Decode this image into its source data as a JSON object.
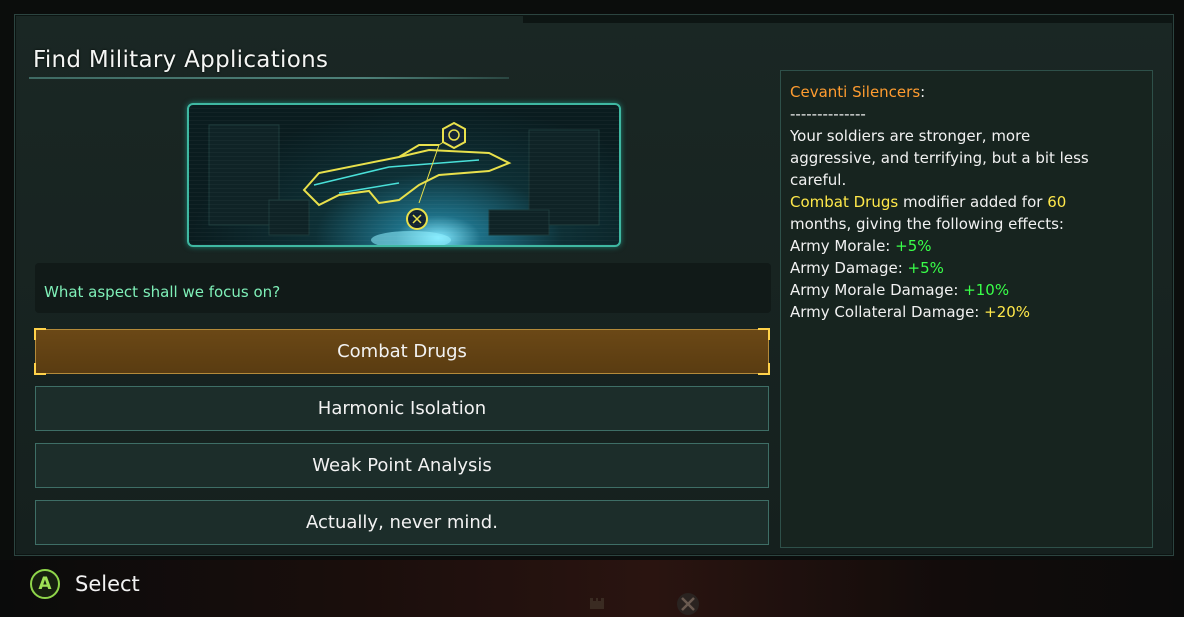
{
  "window": {
    "title": "Find Military Applications"
  },
  "picture": {
    "icon": "rifle-hologram-illustration"
  },
  "question": "What aspect shall we focus on?",
  "options": [
    {
      "label": "Combat Drugs",
      "selected": true
    },
    {
      "label": "Harmonic Isolation",
      "selected": false
    },
    {
      "label": "Weak Point Analysis",
      "selected": false
    },
    {
      "label": "Actually, never mind.",
      "selected": false
    }
  ],
  "description": {
    "heading": "Cevanti Silencers",
    "heading_suffix": ":",
    "separator": "--------------",
    "text_line1": "Your soldiers are stronger, more",
    "text_line2": "aggressive, and terrifying, but a bit less",
    "text_line3": "careful.",
    "modifier_name": "Combat Drugs",
    "modifier_mid": " modifier added for ",
    "modifier_duration": "60",
    "modifier_line2": "months, giving the following effects:",
    "effects": [
      {
        "label": "Army Morale: ",
        "value": "+5%",
        "color": "#39ff49"
      },
      {
        "label": "Army Damage: ",
        "value": "+5%",
        "color": "#39ff49"
      },
      {
        "label": "Army Morale Damage: ",
        "value": "+10%",
        "color": "#39ff49"
      },
      {
        "label": "Army Collateral Damage: ",
        "value": "+20%",
        "color": "#ffe84a"
      }
    ]
  },
  "footer": {
    "button_glyph": "A",
    "label": "Select"
  },
  "colors": {
    "accent_teal": "#3fb8a2",
    "selected_fill": "#6b4816",
    "selected_corner": "#ffd24a",
    "heading_orange": "#ff9c30",
    "highlight_yellow": "#ffe84a",
    "positive_green": "#39ff49"
  }
}
